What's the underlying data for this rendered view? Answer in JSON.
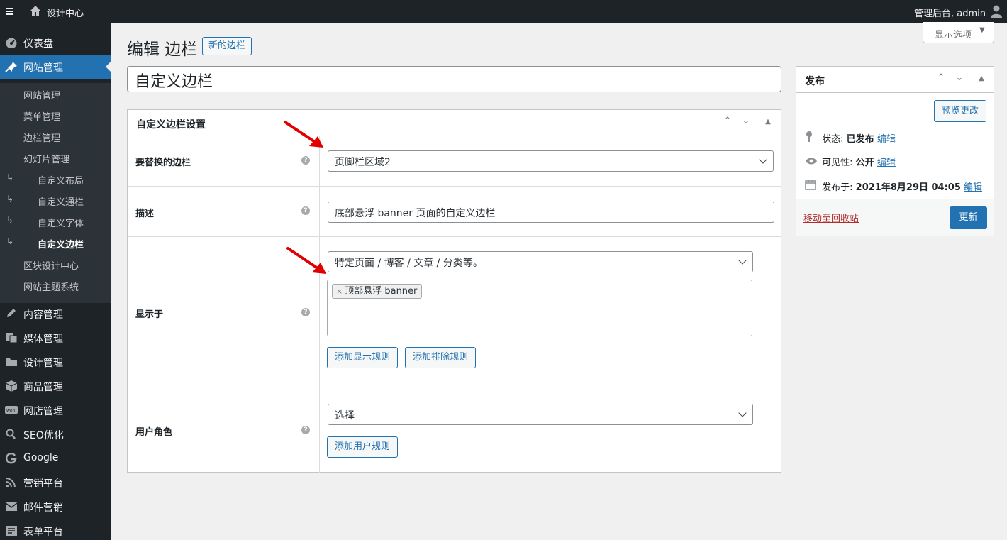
{
  "adminbar": {
    "site_name": "设计中心",
    "account": "管理后台, admin"
  },
  "sidebar": {
    "top_items": [
      {
        "label": "仪表盘",
        "icon": "dashboard-icon"
      },
      {
        "label": "网站管理",
        "icon": "pin-icon",
        "active": true
      },
      {
        "label": "内容管理",
        "icon": "pencil-icon"
      },
      {
        "label": "媒体管理",
        "icon": "media-icon"
      },
      {
        "label": "设计管理",
        "icon": "folder-icon"
      },
      {
        "label": "商品管理",
        "icon": "box-icon"
      },
      {
        "label": "网店管理",
        "icon": "woo-icon"
      },
      {
        "label": "SEO优化",
        "icon": "search-icon"
      },
      {
        "label": "Google",
        "icon": "google-icon"
      },
      {
        "label": "营销平台",
        "icon": "rss-icon"
      },
      {
        "label": "邮件营销",
        "icon": "mail-icon"
      },
      {
        "label": "表单平台",
        "icon": "form-icon"
      }
    ],
    "sub_items": [
      {
        "label": "网站管理"
      },
      {
        "label": "菜单管理"
      },
      {
        "label": "边栏管理"
      },
      {
        "label": "幻灯片管理"
      },
      {
        "label": "自定义布局",
        "child": true
      },
      {
        "label": "自定义通栏",
        "child": true
      },
      {
        "label": "自定义字体",
        "child": true
      },
      {
        "label": "自定义边栏",
        "child": true,
        "current": true
      },
      {
        "label": "区块设计中心"
      },
      {
        "label": "网站主题系统"
      }
    ]
  },
  "screen_options": {
    "label": "显示选项"
  },
  "page": {
    "title": "编辑 边栏",
    "add_new": "新的边栏",
    "post_title": "自定义边栏"
  },
  "settings": {
    "box_title": "自定义边栏设置",
    "replace": {
      "label": "要替换的边栏",
      "value": "页脚栏区域2"
    },
    "description": {
      "label": "描述",
      "value": "底部悬浮 banner 页面的自定义边栏"
    },
    "display": {
      "label": "显示于",
      "select_value": "特定页面 / 博客 / 文章 / 分类等。",
      "tag": "顶部悬浮 banner",
      "add_display_rule": "添加显示规则",
      "add_exclude_rule": "添加排除规则"
    },
    "user_role": {
      "label": "用户角色",
      "select_value": "选择",
      "add_user_rule": "添加用户规则"
    }
  },
  "publish": {
    "title": "发布",
    "preview": "预览更改",
    "status_label": "状态:",
    "status_value": "已发布",
    "visibility_label": "可见性:",
    "visibility_value": "公开",
    "published_label": "发布于:",
    "published_value": "2021年8月29日 04:05",
    "edit": "编辑",
    "trash": "移动至回收站",
    "update": "更新"
  },
  "colors": {
    "accent": "#2271b1",
    "sidebar_bg": "#1d2327",
    "submenu_bg": "#2c3338",
    "danger": "#b32d2e",
    "annotation_arrow": "#e00000"
  }
}
